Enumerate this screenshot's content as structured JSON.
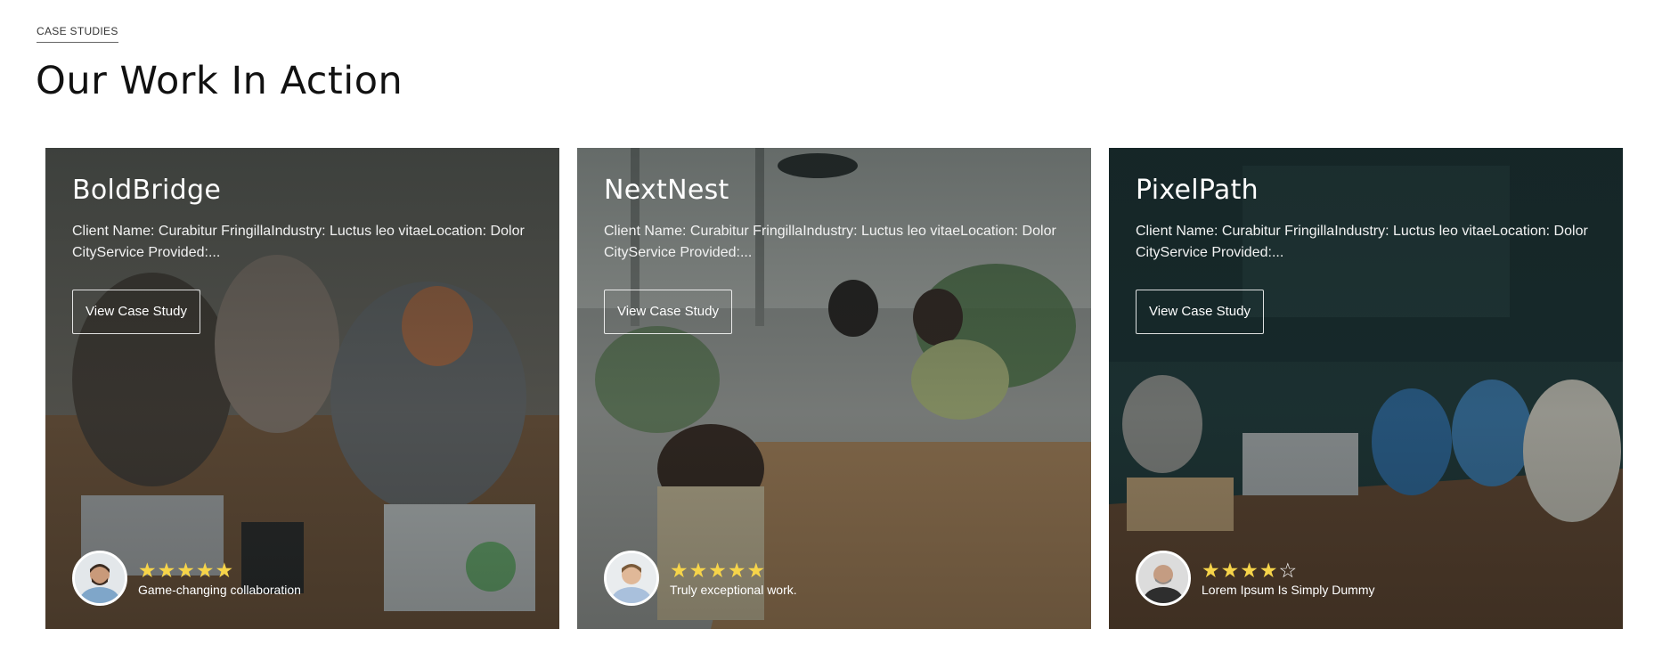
{
  "section": {
    "eyebrow": "CASE STUDIES",
    "title": "Our Work In Action"
  },
  "cards": [
    {
      "title": "BoldBridge",
      "description": "Client Name: Curabitur FringillaIndustry: Luctus leo vitaeLocation: Dolor CityService Provided:...",
      "button_label": "View Case Study",
      "rating": 5,
      "review": "Game-changing collaboration"
    },
    {
      "title": "NextNest",
      "description": "Client Name: Curabitur FringillaIndustry: Luctus leo vitaeLocation: Dolor CityService Provided:...",
      "button_label": "View Case Study",
      "rating": 5,
      "review": "Truly exceptional work."
    },
    {
      "title": "PixelPath",
      "description": "Client Name: Curabitur FringillaIndustry: Luctus leo vitaeLocation: Dolor CityService Provided:...",
      "button_label": "View Case Study",
      "rating": 4,
      "review": "Lorem Ipsum Is Simply Dummy"
    }
  ],
  "colors": {
    "star": "#f6d44a",
    "heading": "#111111"
  },
  "icons": {
    "star_full": "star-filled-icon",
    "star_empty": "star-outline-icon"
  }
}
